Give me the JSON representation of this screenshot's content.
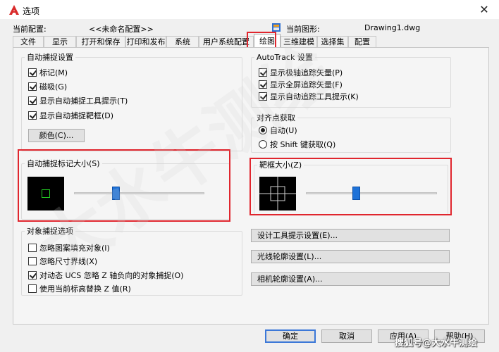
{
  "window": {
    "title": "选项",
    "close_glyph": "✕"
  },
  "header": {
    "current_profile_label": "当前配置:",
    "current_profile_value": "<<未命名配置>>",
    "current_drawing_label": "当前图形:",
    "current_drawing_value": "Drawing1.dwg"
  },
  "tabs": [
    {
      "label": "文件"
    },
    {
      "label": "显示"
    },
    {
      "label": "打开和保存"
    },
    {
      "label": "打印和发布"
    },
    {
      "label": "系统"
    },
    {
      "label": "用户系统配置"
    },
    {
      "label": "绘图",
      "active": true
    },
    {
      "label": "三维建模"
    },
    {
      "label": "选择集"
    },
    {
      "label": "配置"
    }
  ],
  "autosnap": {
    "legend": "自动捕捉设置",
    "items": [
      {
        "label": "标记(M)",
        "checked": true
      },
      {
        "label": "磁吸(G)",
        "checked": true
      },
      {
        "label": "显示自动捕捉工具提示(T)",
        "checked": true
      },
      {
        "label": "显示自动捕捉靶框(D)",
        "checked": true
      }
    ],
    "color_button": "颜色(C)..."
  },
  "autosnap_size": {
    "legend": "自动捕捉标记大小(S)",
    "value_fraction": 0.32
  },
  "object_snap_options": {
    "legend": "对象捕捉选项",
    "items": [
      {
        "label": "忽略图案填充对象(I)",
        "checked": false
      },
      {
        "label": "忽略尺寸界线(X)",
        "checked": false
      },
      {
        "label": "对动态 UCS 忽略 Z 轴负向的对象捕捉(O)",
        "checked": true
      },
      {
        "label": "使用当前标高替换 Z 值(R)",
        "checked": false
      }
    ]
  },
  "autotrack": {
    "legend": "AutoTrack 设置",
    "items": [
      {
        "label": "显示极轴追踪矢量(P)",
        "checked": true
      },
      {
        "label": "显示全屏追踪矢量(F)",
        "checked": true
      },
      {
        "label": "显示自动追踪工具提示(K)",
        "checked": true
      }
    ]
  },
  "alignment": {
    "legend": "对齐点获取",
    "options": [
      {
        "label": "自动(U)",
        "selected": true
      },
      {
        "label": "按 Shift 键获取(Q)",
        "selected": false
      }
    ]
  },
  "aperture_size": {
    "legend": "靶框大小(Z)",
    "value_fraction": 0.38
  },
  "side_buttons": {
    "tooltip": "设计工具提示设置(E)...",
    "lights": "光线轮廓设置(L)...",
    "camera": "相机轮廓设置(A)..."
  },
  "footer": {
    "ok": "确定",
    "cancel": "取消",
    "apply": "应用(A)",
    "help": "帮助(H)"
  },
  "watermark": {
    "text": "搜狐号@大水牛测绘",
    "background_text": "大水牛测绘"
  },
  "colors": {
    "accent_red": "#e0262e",
    "slider_thumb": "#1e72d8",
    "snap_marker": "#22cc22"
  }
}
